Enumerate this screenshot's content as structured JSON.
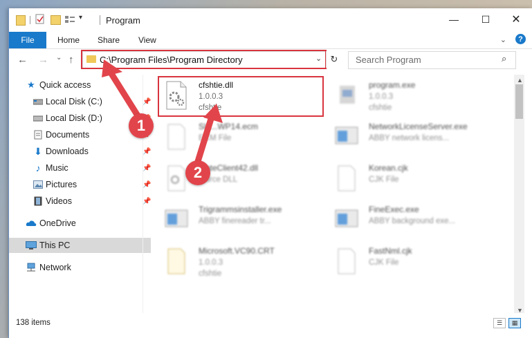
{
  "window": {
    "title": "Program"
  },
  "ribbon": {
    "tabs": [
      "File",
      "Home",
      "Share",
      "View"
    ],
    "help": "?"
  },
  "address": {
    "path": "C:\\Program Files\\Program Directory"
  },
  "search": {
    "placeholder": "Search Program"
  },
  "nav": {
    "items": [
      {
        "label": "Quick access",
        "icon": "star-icon"
      },
      {
        "label": "Local Disk (C:)",
        "icon": "drive-icon"
      },
      {
        "label": "Local Disk (D:)",
        "icon": "drive-icon"
      },
      {
        "label": "Documents",
        "icon": "documents-icon"
      },
      {
        "label": "Downloads",
        "icon": "download-icon"
      },
      {
        "label": "Music",
        "icon": "music-icon"
      },
      {
        "label": "Pictures",
        "icon": "pictures-icon"
      },
      {
        "label": "Videos",
        "icon": "videos-icon"
      },
      {
        "label": "OneDrive",
        "icon": "cloud-icon"
      },
      {
        "label": "This PC",
        "icon": "computer-icon"
      },
      {
        "label": "Network",
        "icon": "network-icon"
      }
    ]
  },
  "files": [
    {
      "name": "cfshtie.dll",
      "sub1": "1.0.0.3",
      "sub2": "cfshtie"
    },
    {
      "name": "program.exe",
      "sub1": "1.0.0.3",
      "sub2": "cfshtie"
    },
    {
      "name": "Sla...WP14.ecm",
      "sub1": "ECM File",
      "sub2": ""
    },
    {
      "name": "NetworkLicenseServer.exe",
      "sub1": "ABBY network licens...",
      "sub2": ""
    },
    {
      "name": "...ateClient42.dll",
      "sub1": "...urce DLL",
      "sub2": ""
    },
    {
      "name": "Korean.cjk",
      "sub1": "CJK File",
      "sub2": ""
    },
    {
      "name": "Trigrammsinstaller.exe",
      "sub1": "ABBY finereader tr...",
      "sub2": ""
    },
    {
      "name": "FineExec.exe",
      "sub1": "ABBY background exe...",
      "sub2": ""
    },
    {
      "name": "Microsoft.VC90.CRT",
      "sub1": "1.0.0.3",
      "sub2": "cfshtie"
    },
    {
      "name": "FastNml.cjk",
      "sub1": "CJK File",
      "sub2": ""
    }
  ],
  "callouts": [
    "1",
    "2"
  ],
  "status": {
    "count": "138 items"
  },
  "colors": {
    "accent": "#1979ca",
    "callout": "#e1454b",
    "highlight": "#d8343e"
  }
}
